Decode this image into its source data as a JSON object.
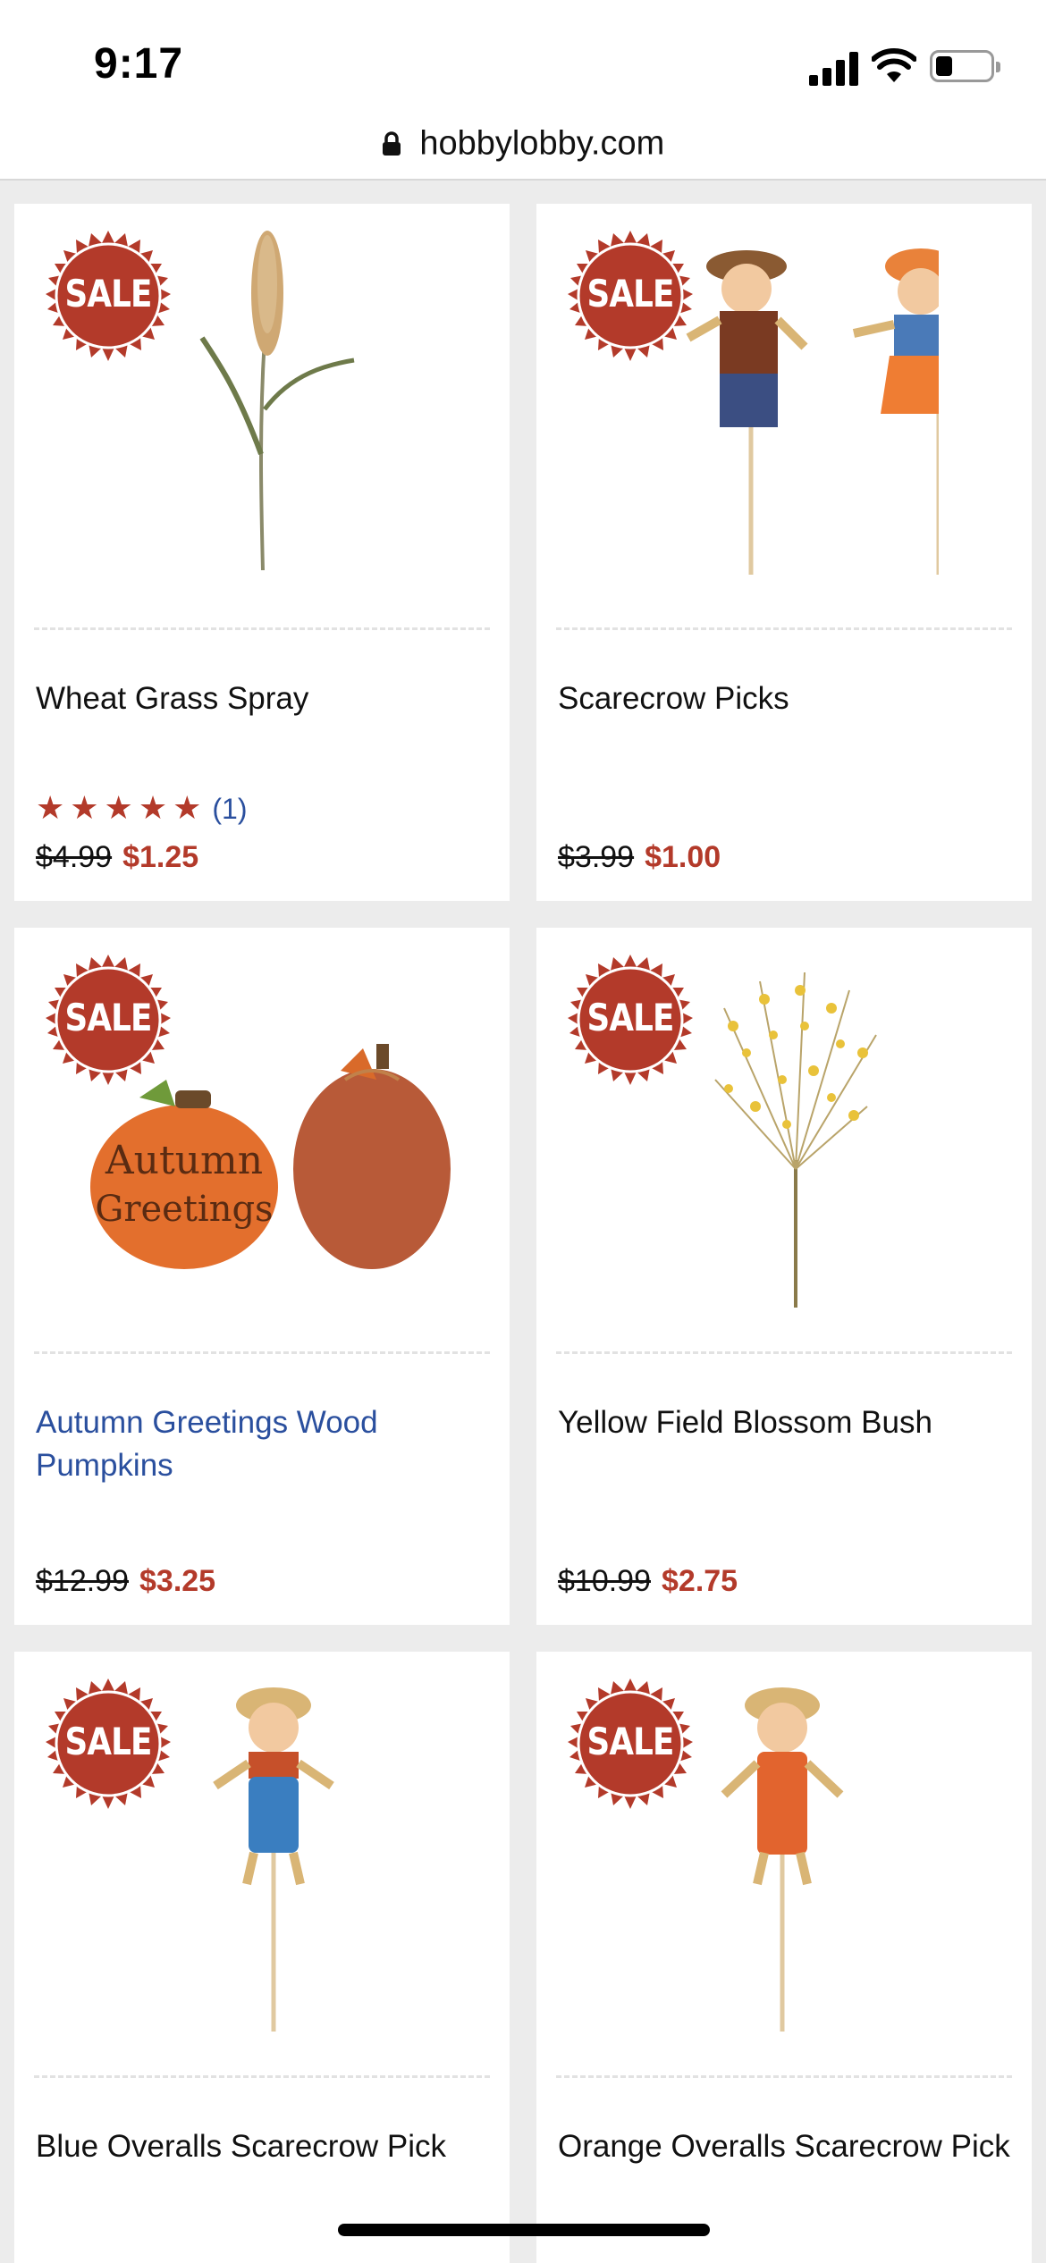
{
  "status": {
    "time": "9:17"
  },
  "browser": {
    "url": "hobbylobby.com"
  },
  "colors": {
    "sale": "#b33a2a",
    "link": "#2a4f9e"
  },
  "sale_badge": "SALE",
  "products": [
    {
      "name": "Wheat Grass Spray",
      "old_price": "$4.99",
      "new_price": "$1.25",
      "rating_stars": "★★★★★",
      "review_count": "(1)",
      "image": "wheat-grass"
    },
    {
      "name": "Scarecrow Picks",
      "old_price": "$3.99",
      "new_price": "$1.00",
      "image": "scarecrow-pair"
    },
    {
      "name": "Autumn Greetings Wood Pumpkins",
      "old_price": "$12.99",
      "new_price": "$3.25",
      "image": "wood-pumpkins",
      "image_text": [
        "Autumn",
        "Greetings"
      ]
    },
    {
      "name": "Yellow Field Blossom Bush",
      "old_price": "$10.99",
      "new_price": "$2.75",
      "image": "yellow-blossom"
    },
    {
      "name": "Blue Overalls Scarecrow Pick",
      "image": "scarecrow-blue"
    },
    {
      "name": "Orange Overalls Scarecrow Pick",
      "image": "scarecrow-orange"
    }
  ]
}
